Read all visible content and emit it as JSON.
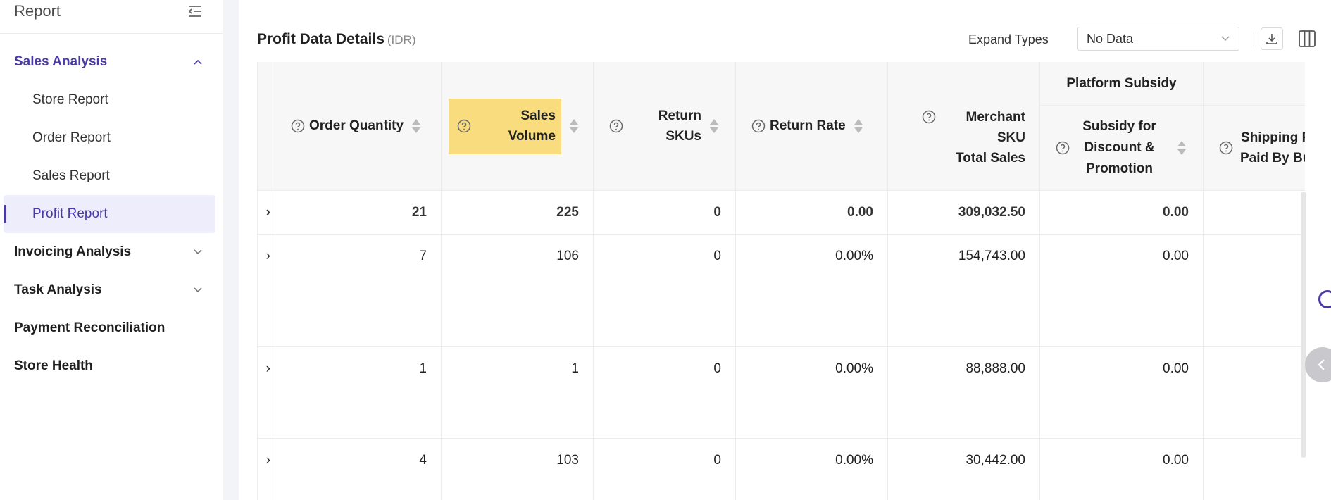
{
  "sidebar": {
    "title": "Report",
    "groups": [
      {
        "label": "Sales Analysis",
        "expanded": true
      },
      {
        "label": "Invoicing Analysis",
        "expanded": false
      },
      {
        "label": "Task Analysis",
        "expanded": false
      },
      {
        "label": "Payment Reconciliation"
      },
      {
        "label": "Store Health"
      }
    ],
    "items": [
      "Store Report",
      "Order Report",
      "Sales Report",
      "Profit Report"
    ],
    "selected_item": "Profit Report"
  },
  "toolbar": {
    "title": "Profit Data Details",
    "currency": "(IDR)",
    "expand_label": "Expand Types",
    "expand_value": "No Data"
  },
  "table": {
    "columns": {
      "order_quantity": "Order Quantity",
      "sales_volume_1": "Sales",
      "sales_volume_2": "Volume",
      "return_skus_1": "Return",
      "return_skus_2": "SKUs",
      "return_rate": "Return Rate",
      "merchant_sku_1": "Merchant SKU",
      "merchant_sku_2": "Total Sales",
      "platform_subsidy": "Platform Subsidy",
      "subsidy_1": "Subsidy for",
      "subsidy_2": "Discount &",
      "subsidy_3": "Promotion",
      "shipping_1": "Shipping F",
      "shipping_2": "Paid By Bu"
    },
    "rows": [
      {
        "prefix": "›",
        "order_quantity": "21",
        "sales_volume": "225",
        "return_skus": "0",
        "return_rate": "0.00",
        "merchant_sku_total": "309,032.50",
        "subsidy": "0.00"
      },
      {
        "prefix": "›",
        "order_quantity": "7",
        "sales_volume": "106",
        "return_skus": "0",
        "return_rate": "0.00%",
        "merchant_sku_total": "154,743.00",
        "subsidy": "0.00"
      },
      {
        "prefix": "›",
        "order_quantity": "1",
        "sales_volume": "1",
        "return_skus": "0",
        "return_rate": "0.00%",
        "merchant_sku_total": "88,888.00",
        "subsidy": "0.00"
      },
      {
        "prefix": "›",
        "order_quantity": "4",
        "sales_volume": "103",
        "return_skus": "0",
        "return_rate": "0.00%",
        "merchant_sku_total": "30,442.00",
        "subsidy": "0.00"
      }
    ]
  },
  "icons": {
    "collapse": "collapse-sidebar-icon",
    "download": "download-icon",
    "columns": "columns-icon",
    "help": "question-circle-icon",
    "sort": "sort-icon"
  },
  "colors": {
    "accent": "#4a3aa8",
    "selected_bg": "#eeedfc",
    "highlight": "#f8dc7e"
  }
}
